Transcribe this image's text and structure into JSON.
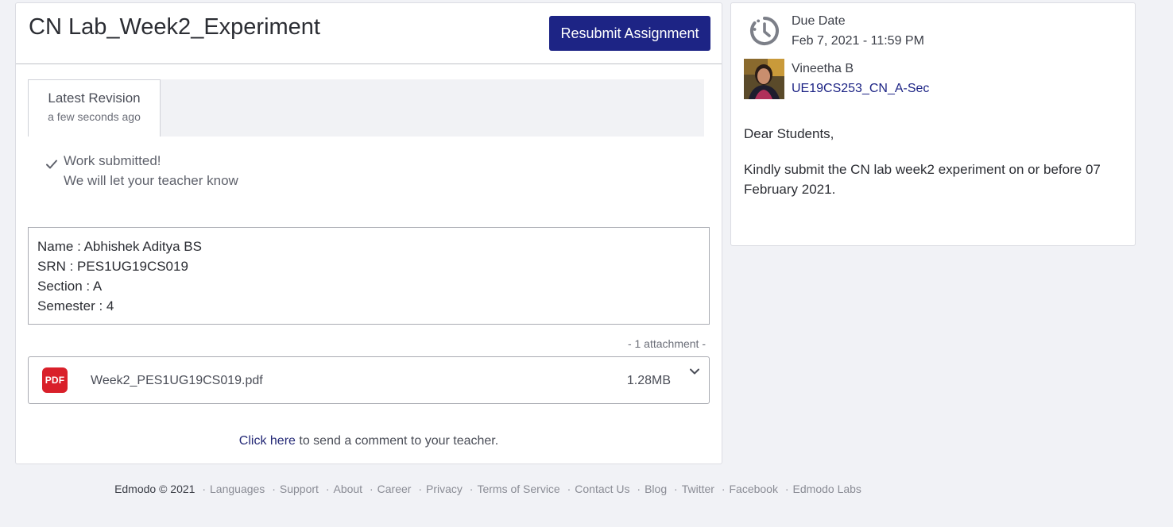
{
  "assignment": {
    "title": "CN Lab_Week2_Experiment",
    "resubmit_label": "Resubmit Assignment"
  },
  "revision": {
    "tab_label": "Latest Revision",
    "tab_time": "a few seconds ago"
  },
  "status": {
    "line1": "Work submitted!",
    "line2": "We will let your teacher know"
  },
  "submission": {
    "lines": [
      "Name : Abhishek Aditya BS",
      "SRN : PES1UG19CS019",
      "Section : A",
      "Semester : 4"
    ]
  },
  "attachments": {
    "count_label": "- 1 attachment  -",
    "items": [
      {
        "icon": "pdf-icon",
        "icon_text": "PDF",
        "name": "Week2_PES1UG19CS019.pdf",
        "size": "1.28MB"
      }
    ]
  },
  "comment": {
    "link_text": "Click here",
    "rest_text": " to send a comment to your teacher."
  },
  "details": {
    "due_label": "Due Date",
    "due_value": "Feb 7, 2021 - 11:59 PM",
    "teacher_name": "Vineetha B",
    "group_name": "UE19CS253_CN_A-Sec",
    "message": [
      "Dear Students,",
      "Kindly submit the CN lab week2 experiment on or before 07 February 2021."
    ]
  },
  "footer": {
    "copyright": "Edmodo © 2021",
    "separator": "·",
    "links": [
      "Languages",
      "Support",
      "About",
      "Career",
      "Privacy",
      "Terms of Service",
      "Contact Us",
      "Blog",
      "Twitter",
      "Facebook",
      "Edmodo Labs"
    ]
  },
  "colors": {
    "primary": "#1d2485",
    "pdf_red": "#d9202a",
    "page_bg": "#f1f2f6"
  }
}
